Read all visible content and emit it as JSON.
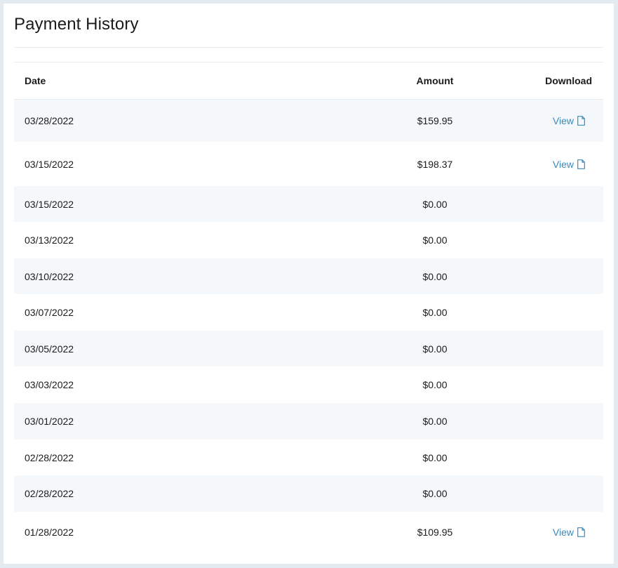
{
  "page": {
    "title": "Payment History"
  },
  "table": {
    "headers": {
      "date": "Date",
      "amount": "Amount",
      "download": "Download"
    },
    "rows": [
      {
        "date": "03/28/2022",
        "amount": "$159.95",
        "download": "View"
      },
      {
        "date": "03/15/2022",
        "amount": "$198.37",
        "download": "View"
      },
      {
        "date": "03/15/2022",
        "amount": "$0.00",
        "download": ""
      },
      {
        "date": "03/13/2022",
        "amount": "$0.00",
        "download": ""
      },
      {
        "date": "03/10/2022",
        "amount": "$0.00",
        "download": ""
      },
      {
        "date": "03/07/2022",
        "amount": "$0.00",
        "download": ""
      },
      {
        "date": "03/05/2022",
        "amount": "$0.00",
        "download": ""
      },
      {
        "date": "03/03/2022",
        "amount": "$0.00",
        "download": ""
      },
      {
        "date": "03/01/2022",
        "amount": "$0.00",
        "download": ""
      },
      {
        "date": "02/28/2022",
        "amount": "$0.00",
        "download": ""
      },
      {
        "date": "02/28/2022",
        "amount": "$0.00",
        "download": ""
      },
      {
        "date": "01/28/2022",
        "amount": "$109.95",
        "download": "View"
      }
    ]
  },
  "icons": {
    "download_link": "document-icon"
  },
  "colors": {
    "link": "#3a8ab8",
    "row_alt": "#f4f8fb",
    "text": "#1b1b1b"
  }
}
